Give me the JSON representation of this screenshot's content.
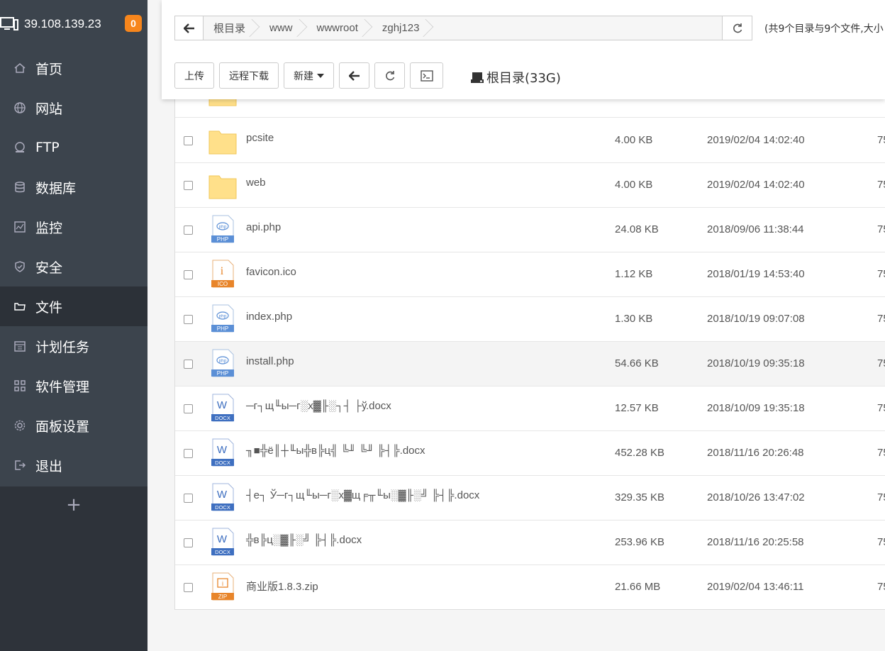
{
  "sidebar": {
    "ip": "39.108.139.23",
    "badge": "0",
    "items": [
      {
        "label": "首页",
        "icon": "home-icon"
      },
      {
        "label": "网站",
        "icon": "globe-icon"
      },
      {
        "label": "FTP",
        "icon": "ftp-icon"
      },
      {
        "label": "数据库",
        "icon": "database-icon"
      },
      {
        "label": "监控",
        "icon": "monitor-chart-icon"
      },
      {
        "label": "安全",
        "icon": "shield-icon"
      },
      {
        "label": "文件",
        "icon": "folder-icon",
        "active": true
      },
      {
        "label": "计划任务",
        "icon": "calendar-icon"
      },
      {
        "label": "软件管理",
        "icon": "apps-grid-icon"
      },
      {
        "label": "面板设置",
        "icon": "gear-icon"
      },
      {
        "label": "退出",
        "icon": "logout-icon"
      }
    ],
    "add_label": "+"
  },
  "pathbar": {
    "crumbs": [
      "根目录",
      "www",
      "wwwroot",
      "zghj123"
    ]
  },
  "summary": "(共9个目录与9个文件,大小",
  "toolbar": {
    "upload": "上传",
    "remote_download": "远程下载",
    "new": "新建",
    "disk": "根目录(33G)"
  },
  "files": [
    {
      "name": "pcsite",
      "type": "folder",
      "size": "4.00 KB",
      "time": "2019/02/04 14:02:40",
      "perm": "75"
    },
    {
      "name": "web",
      "type": "folder",
      "size": "4.00 KB",
      "time": "2019/02/04 14:02:40",
      "perm": "75"
    },
    {
      "name": "api.php",
      "type": "php",
      "size": "24.08 KB",
      "time": "2018/09/06 11:38:44",
      "perm": "75"
    },
    {
      "name": "favicon.ico",
      "type": "ico",
      "size": "1.12 KB",
      "time": "2018/01/19 14:53:40",
      "perm": "75"
    },
    {
      "name": "index.php",
      "type": "php",
      "size": "1.30 KB",
      "time": "2018/10/19 09:07:08",
      "perm": "75"
    },
    {
      "name": "install.php",
      "type": "php",
      "size": "54.66 KB",
      "time": "2018/10/19 09:35:18",
      "perm": "75"
    },
    {
      "name": "─г┐щ╙ы─г░х▓╟░┐┤ ├ў.docx",
      "type": "docx",
      "size": "12.57 KB",
      "time": "2018/10/09 19:35:18",
      "perm": "75"
    },
    {
      "name": "╖■╬ё║┼╙ы╬в╠ц╣ ╚╜ ╚╜ ╠┤╠.docx",
      "type": "docx",
      "size": "452.28 KB",
      "time": "2018/11/16 20:26:48",
      "perm": "75"
    },
    {
      "name": "┤е┐ Ў─г┐щ╙ы─г░х▓щ╒╥╙ы░▓╟░╝ ╠┤╠.docx",
      "type": "docx",
      "size": "329.35 KB",
      "time": "2018/10/26 13:47:02",
      "perm": "75"
    },
    {
      "name": "╬в╠ц░▓╟░╝ ╠┤╠.docx",
      "type": "docx",
      "size": "253.96 KB",
      "time": "2018/11/16 20:25:58",
      "perm": "75"
    },
    {
      "name": "商业版1.8.3.zip",
      "type": "zip",
      "size": "21.66 MB",
      "time": "2019/02/04 13:46:11",
      "perm": "75"
    }
  ],
  "colors": {
    "sidebar_bg": "#3c444d",
    "sidebar_active": "#2c3138",
    "badge": "#f7861c",
    "folder": "#ffe08a",
    "php_blue": "#5b8fd6",
    "ico_orange": "#e8852a",
    "docx_blue": "#3e6fc0"
  }
}
